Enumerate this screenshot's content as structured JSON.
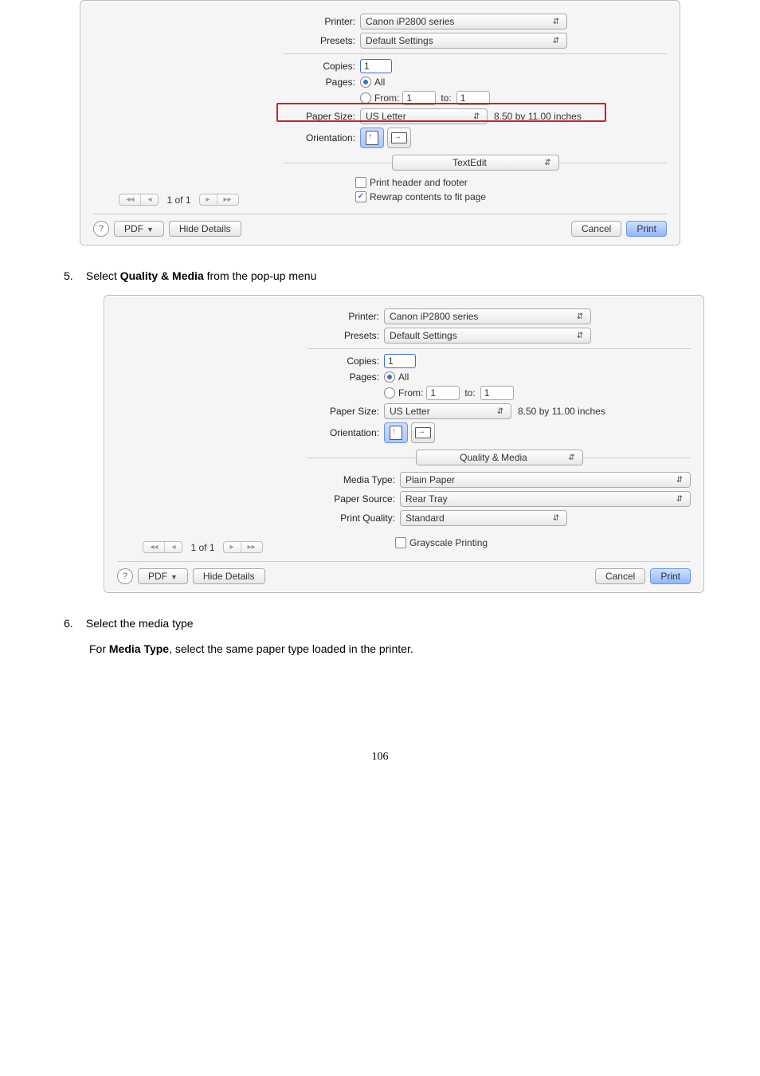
{
  "dialog1": {
    "printer_label": "Printer:",
    "printer_value": "Canon iP2800 series",
    "presets_label": "Presets:",
    "presets_value": "Default Settings",
    "copies_label": "Copies:",
    "copies_value": "1",
    "pages_label": "Pages:",
    "pages_all_label": "All",
    "pages_from_label": "From:",
    "pages_from_value": "1",
    "pages_to_label": "to:",
    "pages_to_value": "1",
    "paper_size_label": "Paper Size:",
    "paper_size_value": "US Letter",
    "paper_dims": "8.50 by 11.00 inches",
    "orientation_label": "Orientation:",
    "section_popup": "TextEdit",
    "cb_header_label": "Print header and footer",
    "cb_rewrap_label": "Rewrap contents to fit page",
    "nav_text": "1 of 1",
    "help": "?",
    "pdf_label": "PDF",
    "hide_details": "Hide Details",
    "cancel": "Cancel",
    "print": "Print"
  },
  "instr5": {
    "num": "5.",
    "text_a": "Select ",
    "text_bold": "Quality & Media",
    "text_b": " from the pop-up menu"
  },
  "dialog2": {
    "printer_label": "Printer:",
    "printer_value": "Canon iP2800 series",
    "presets_label": "Presets:",
    "presets_value": "Default Settings",
    "copies_label": "Copies:",
    "copies_value": "1",
    "pages_label": "Pages:",
    "pages_all_label": "All",
    "pages_from_label": "From:",
    "pages_from_value": "1",
    "pages_to_label": "to:",
    "pages_to_value": "1",
    "paper_size_label": "Paper Size:",
    "paper_size_value": "US Letter",
    "paper_dims": "8.50 by 11.00 inches",
    "orientation_label": "Orientation:",
    "section_popup": "Quality & Media",
    "media_type_label": "Media Type:",
    "media_type_value": "Plain Paper",
    "paper_source_label": "Paper Source:",
    "paper_source_value": "Rear Tray",
    "print_quality_label": "Print Quality:",
    "print_quality_value": "Standard",
    "grayscale_label": "Grayscale Printing",
    "nav_text": "1 of 1",
    "help": "?",
    "pdf_label": "PDF",
    "hide_details": "Hide Details",
    "cancel": "Cancel",
    "print": "Print"
  },
  "instr6": {
    "num": "6.",
    "text": "Select the media type",
    "para_a": "For ",
    "para_bold": "Media Type",
    "para_b": ", select the same paper type loaded in the printer."
  },
  "page_number": "106"
}
